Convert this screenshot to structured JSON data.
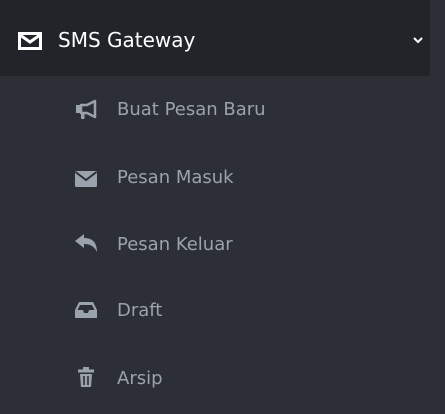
{
  "menu": {
    "title": "SMS Gateway",
    "icon": "envelope-icon",
    "expanded_icon": "chevron-down-icon",
    "colors": {
      "header_bg": "#212428",
      "submenu_bg": "#2c3036",
      "header_text": "#ffffff",
      "item_text": "#9aa3ab"
    },
    "items": [
      {
        "label": "Buat Pesan Baru",
        "icon": "bullhorn-icon"
      },
      {
        "label": "Pesan Masuk",
        "icon": "envelope-icon"
      },
      {
        "label": "Pesan Keluar",
        "icon": "reply-icon"
      },
      {
        "label": "Draft",
        "icon": "inbox-icon"
      },
      {
        "label": "Arsip",
        "icon": "trash-icon"
      }
    ]
  }
}
